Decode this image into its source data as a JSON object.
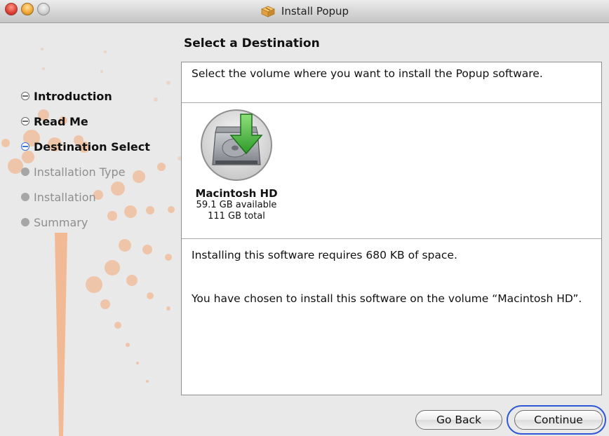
{
  "window": {
    "title": "Install Popup"
  },
  "sidebar": {
    "steps": [
      {
        "label": "Introduction",
        "state": "done"
      },
      {
        "label": "Read Me",
        "state": "done"
      },
      {
        "label": "Destination Select",
        "state": "current"
      },
      {
        "label": "Installation Type",
        "state": "pending"
      },
      {
        "label": "Installation",
        "state": "pending"
      },
      {
        "label": "Summary",
        "state": "pending"
      }
    ]
  },
  "main": {
    "heading": "Select a Destination",
    "instruction": "Select the volume where you want to install the Popup software.",
    "volume": {
      "name": "Macintosh HD",
      "available": "59.1 GB available",
      "total": "111 GB total"
    },
    "space_message": "Installing this software requires 680 KB of space.",
    "chosen_message": "You have chosen to install this software on the volume “Macintosh HD”."
  },
  "buttons": {
    "back": "Go Back",
    "continue": "Continue"
  },
  "colors": {
    "accent_orange": "#f4a878",
    "focus_blue": "#2f57d6"
  }
}
